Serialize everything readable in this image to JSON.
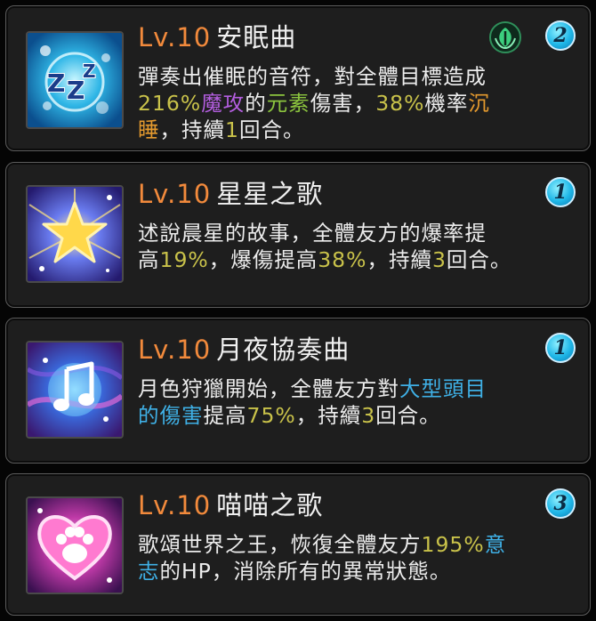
{
  "skills": [
    {
      "level": "Lv.10",
      "name": "安眠曲",
      "badge": "2",
      "element_icon": "leaf-element-icon",
      "desc": [
        {
          "t": "彈奏出催眠的音符，對全體目標造成"
        },
        {
          "br": true
        },
        {
          "t": "216%",
          "c": "lime"
        },
        {
          "t": "魔攻",
          "c": "purple"
        },
        {
          "t": "的"
        },
        {
          "t": "元素",
          "c": "green"
        },
        {
          "t": "傷害，"
        },
        {
          "t": "38%",
          "c": "lime"
        },
        {
          "t": "機率"
        },
        {
          "t": "沉",
          "c": "orange"
        },
        {
          "br": true
        },
        {
          "t": "睡",
          "c": "orange"
        },
        {
          "t": "，持續"
        },
        {
          "t": "1",
          "c": "lime"
        },
        {
          "t": "回合。"
        }
      ],
      "icon": "sleep-zzz-icon"
    },
    {
      "level": "Lv.10",
      "name": "星星之歌",
      "badge": "1",
      "desc": [
        {
          "t": "述說晨星的故事，全體友方的爆率提"
        },
        {
          "br": true
        },
        {
          "t": "高"
        },
        {
          "t": "19%",
          "c": "lime"
        },
        {
          "t": "，爆傷提高"
        },
        {
          "t": "38%",
          "c": "lime"
        },
        {
          "t": "，持續"
        },
        {
          "t": "3",
          "c": "lime"
        },
        {
          "t": "回合。"
        }
      ],
      "icon": "star-icon"
    },
    {
      "level": "Lv.10",
      "name": "月夜協奏曲",
      "badge": "1",
      "desc": [
        {
          "t": "月色狩獵開始，全體友方對"
        },
        {
          "t": "大型頭目",
          "c": "cyan"
        },
        {
          "br": true
        },
        {
          "t": "的傷害",
          "c": "cyan"
        },
        {
          "t": "提高"
        },
        {
          "t": "75%",
          "c": "lime"
        },
        {
          "t": "，持續"
        },
        {
          "t": "3",
          "c": "lime"
        },
        {
          "t": "回合。"
        }
      ],
      "icon": "music-note-icon"
    },
    {
      "level": "Lv.10",
      "name": "喵喵之歌",
      "badge": "3",
      "desc": [
        {
          "t": "歌頌世界之王，恢復全體友方"
        },
        {
          "t": "195%",
          "c": "lime"
        },
        {
          "t": "意",
          "c": "cyan"
        },
        {
          "br": true
        },
        {
          "t": "志",
          "c": "cyan"
        },
        {
          "t": "的HP，消除所有的異常狀態。"
        }
      ],
      "icon": "heart-paw-icon"
    }
  ]
}
